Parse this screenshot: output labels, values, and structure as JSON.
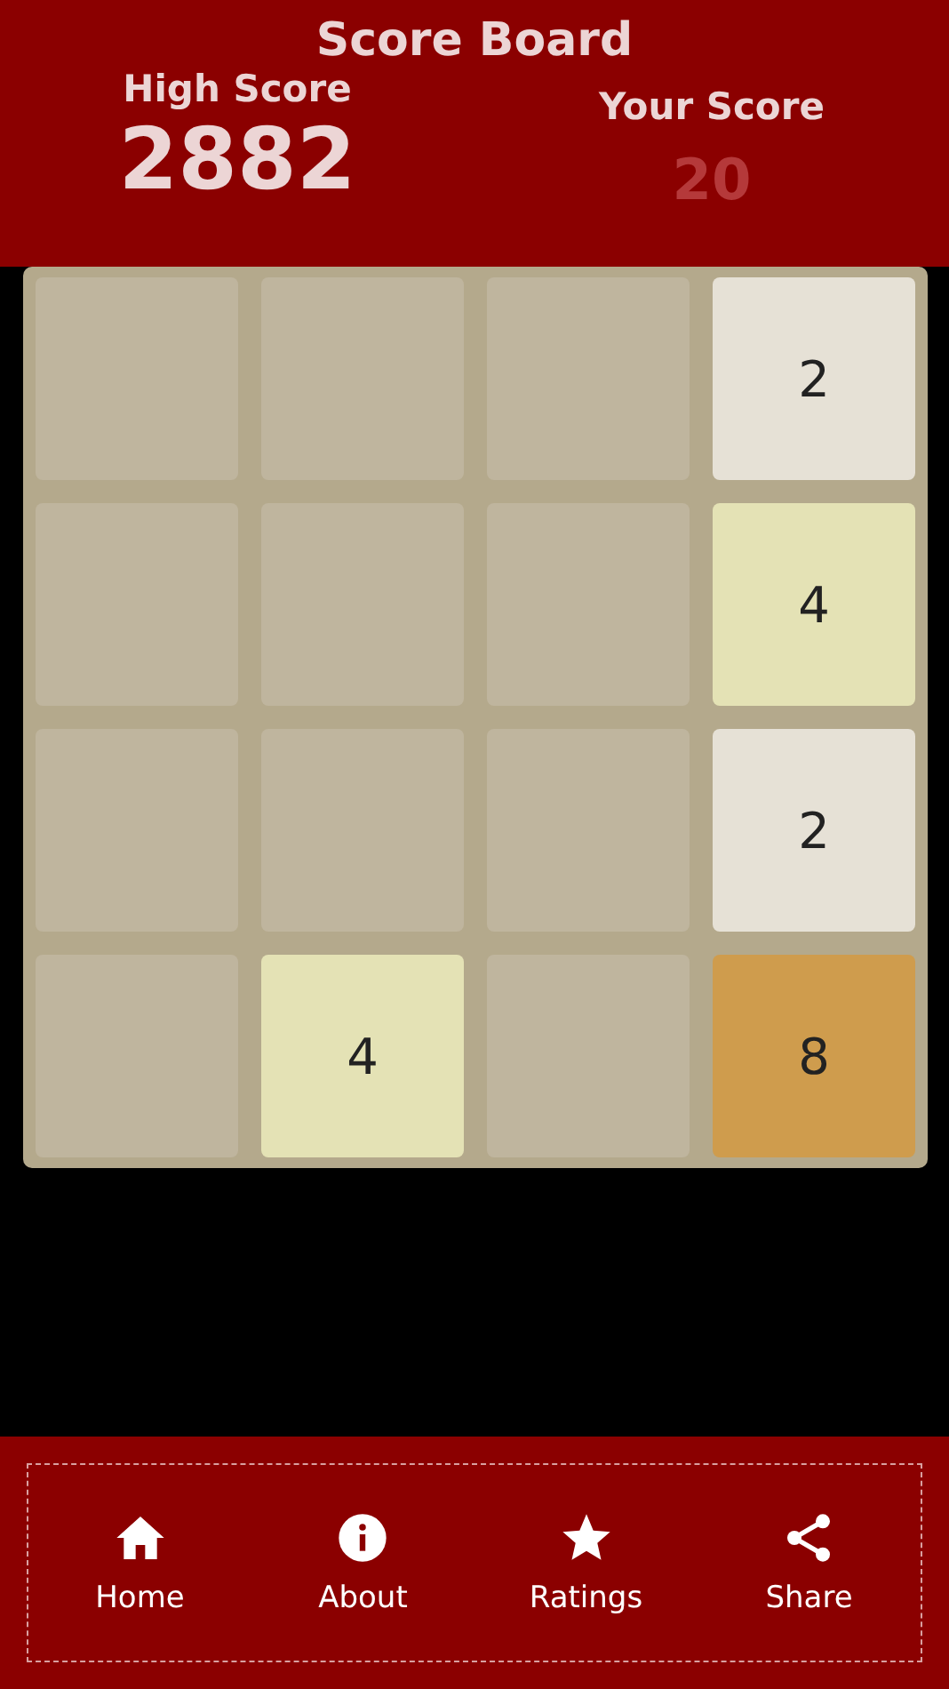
{
  "header": {
    "title": "Score Board",
    "high_score": {
      "label": "High Score",
      "value": "2882"
    },
    "your_score": {
      "label": "Your Score",
      "value": "20"
    }
  },
  "board": {
    "rows": [
      [
        {
          "kind": "empty"
        },
        {
          "kind": "empty"
        },
        {
          "kind": "empty"
        },
        {
          "kind": "tile",
          "value": "2",
          "color": "#e6e1d6"
        }
      ],
      [
        {
          "kind": "empty"
        },
        {
          "kind": "empty"
        },
        {
          "kind": "empty"
        },
        {
          "kind": "tile",
          "value": "4",
          "color": "#e4e2b5"
        }
      ],
      [
        {
          "kind": "empty"
        },
        {
          "kind": "empty"
        },
        {
          "kind": "empty"
        },
        {
          "kind": "tile",
          "value": "2",
          "color": "#e6e1d6"
        }
      ],
      [
        {
          "kind": "empty"
        },
        {
          "kind": "tile",
          "value": "4",
          "color": "#e4e2b5"
        },
        {
          "kind": "empty"
        },
        {
          "kind": "tile",
          "value": "8",
          "color": "#cf9c4d"
        }
      ]
    ]
  },
  "nav": [
    {
      "kind": "home",
      "label": "Home"
    },
    {
      "kind": "about",
      "label": "About"
    },
    {
      "kind": "ratings",
      "label": "Ratings"
    },
    {
      "kind": "share",
      "label": "Share"
    }
  ]
}
